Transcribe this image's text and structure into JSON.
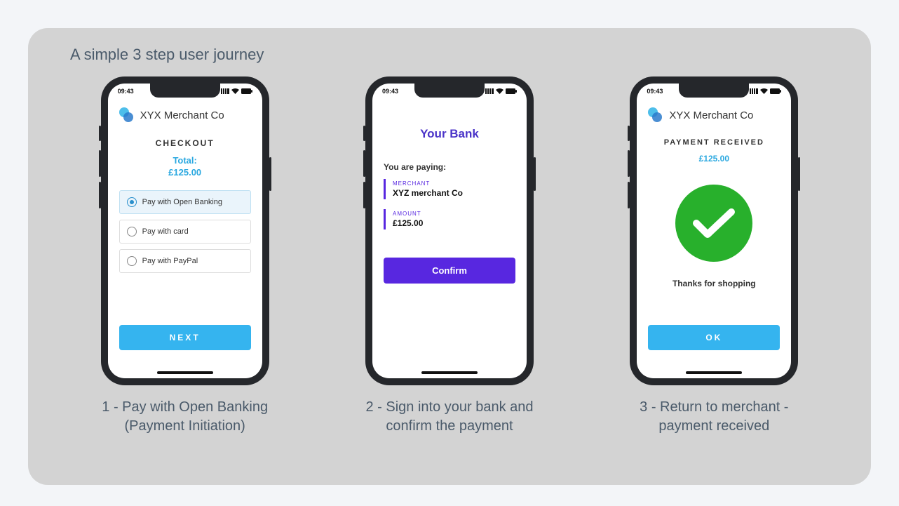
{
  "title": "A simple 3 step user journey",
  "status_time": "09:43",
  "merchant_name": "XYX Merchant Co",
  "colors": {
    "accent_blue": "#35b4ef",
    "accent_purple": "#5827e0",
    "success": "#28b02c",
    "text_muted": "#4a5a6a"
  },
  "step1": {
    "caption_line1": "1 - Pay with Open Banking",
    "caption_line2": "(Payment Initiation)",
    "heading": "CHECKOUT",
    "total_label": "Total:",
    "total_value": "£125.00",
    "options": [
      {
        "label": "Pay with Open Banking",
        "selected": true
      },
      {
        "label": "Pay with card",
        "selected": false
      },
      {
        "label": "Pay with PayPal",
        "selected": false
      }
    ],
    "button": "NEXT"
  },
  "step2": {
    "caption_line1": "2 - Sign into your bank and",
    "caption_line2": "confirm the payment",
    "bank_heading": "Your Bank",
    "paying_label": "You are paying:",
    "merchant_label": "MERCHANT",
    "merchant_value": "XYZ merchant Co",
    "amount_label": "AMOUNT",
    "amount_value": "£125.00",
    "button": "Confirm"
  },
  "step3": {
    "caption_line1": "3 - Return to merchant -",
    "caption_line2": "payment received",
    "heading": "PAYMENT RECEIVED",
    "amount": "£125.00",
    "thanks": "Thanks for shopping",
    "button": "OK"
  }
}
